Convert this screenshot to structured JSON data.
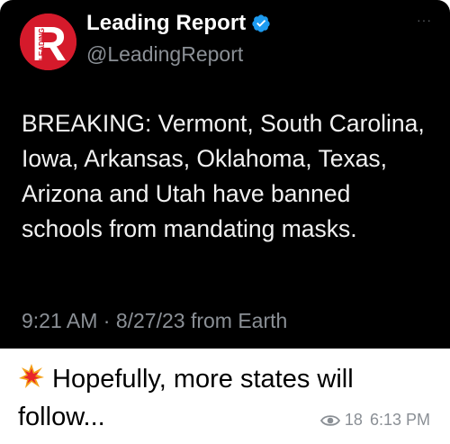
{
  "tweet": {
    "display_name": "Leading Report",
    "handle": "@LeadingReport",
    "logo_letter": "R",
    "logo_side_text": "LEADING",
    "verified_icon": "verified-badge-icon",
    "more_icon": "more-dots-icon",
    "more_label": "···",
    "text": "BREAKING: Vermont, South Carolina, Iowa, Arkansas, Oklahoma, Texas, Arizona and Utah have banned schools from mandating masks.",
    "timestamp": "9:21 AM · 8/27/23 from Earth"
  },
  "message": {
    "emoji_icon": "collision-icon",
    "caption": "Hopefully, more states will follow...",
    "view_icon": "eye-icon",
    "views": "18",
    "time": "6:13 PM"
  },
  "colors": {
    "tweet_background": "#000000",
    "logo_red": "#d51a2b",
    "verified_blue": "#1d9bf0",
    "muted_text": "#8b9096"
  }
}
